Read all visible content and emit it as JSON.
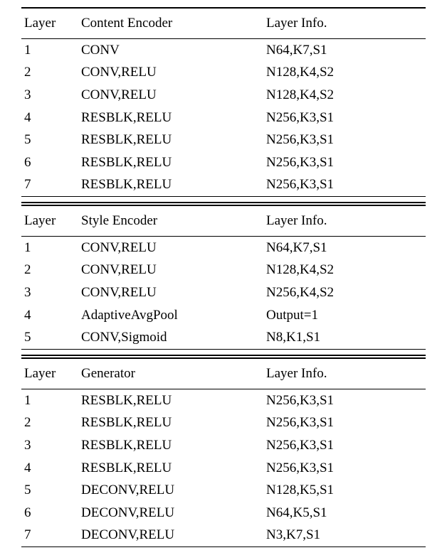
{
  "chart_data": [
    {
      "type": "table",
      "title": "Content Encoder",
      "columns": [
        "Layer",
        "Content Encoder",
        "Layer Info."
      ],
      "rows": [
        [
          "1",
          "CONV",
          "N64,K7,S1"
        ],
        [
          "2",
          "CONV,RELU",
          "N128,K4,S2"
        ],
        [
          "3",
          "CONV,RELU",
          "N128,K4,S2"
        ],
        [
          "4",
          "RESBLK,RELU",
          "N256,K3,S1"
        ],
        [
          "5",
          "RESBLK,RELU",
          "N256,K3,S1"
        ],
        [
          "6",
          "RESBLK,RELU",
          "N256,K3,S1"
        ],
        [
          "7",
          "RESBLK,RELU",
          "N256,K3,S1"
        ]
      ]
    },
    {
      "type": "table",
      "title": "Style Encoder",
      "columns": [
        "Layer",
        "Style Encoder",
        "Layer Info."
      ],
      "rows": [
        [
          "1",
          "CONV,RELU",
          "N64,K7,S1"
        ],
        [
          "2",
          "CONV,RELU",
          "N128,K4,S2"
        ],
        [
          "3",
          "CONV,RELU",
          "N256,K4,S2"
        ],
        [
          "4",
          "AdaptiveAvgPool",
          "Output=1"
        ],
        [
          "5",
          "CONV,Sigmoid",
          "N8,K1,S1"
        ]
      ]
    },
    {
      "type": "table",
      "title": "Generator",
      "columns": [
        "Layer",
        "Generator",
        "Layer Info."
      ],
      "rows": [
        [
          "1",
          "RESBLK,RELU",
          "N256,K3,S1"
        ],
        [
          "2",
          "RESBLK,RELU",
          "N256,K3,S1"
        ],
        [
          "3",
          "RESBLK,RELU",
          "N256,K3,S1"
        ],
        [
          "4",
          "RESBLK,RELU",
          "N256,K3,S1"
        ],
        [
          "5",
          "DECONV,RELU",
          "N128,K5,S1"
        ],
        [
          "6",
          "DECONV,RELU",
          "N64,K5,S1"
        ],
        [
          "7",
          "DECONV,RELU",
          "N3,K7,S1"
        ]
      ]
    }
  ]
}
